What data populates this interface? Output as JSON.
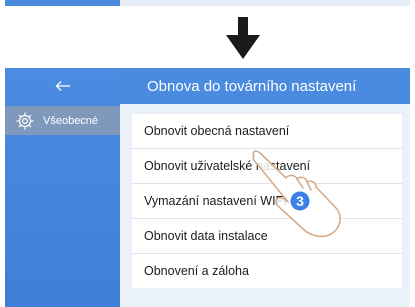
{
  "header": {
    "title": "Obnova do továrního nastavení"
  },
  "sidebar": {
    "back_icon": "arrow-left-icon",
    "items": [
      {
        "label": "Všeobecné",
        "icon": "gear-icon"
      }
    ]
  },
  "main": {
    "options": [
      {
        "label": "Obnovit obecná nastavení"
      },
      {
        "label": "Obnovit uživatelské nastavení"
      },
      {
        "label": "Vymazání nastavení WIFI"
      },
      {
        "label": "Obnovit data instalace"
      },
      {
        "label": "Obnovení a záloha"
      }
    ]
  },
  "annotation": {
    "step": "3",
    "step_color": "#3b82e8",
    "flow_arrow_icon": "arrow-down-icon",
    "pointer_icon": "pointing-hand-icon"
  },
  "colors": {
    "accent": "#4a8be0",
    "sidebar_selected": "#7f99bd",
    "background": "#eaf1f8"
  }
}
